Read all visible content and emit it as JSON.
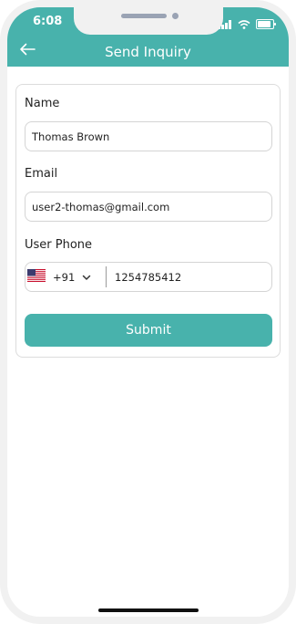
{
  "status_bar": {
    "time": "6:08"
  },
  "header": {
    "title": "Send Inquiry"
  },
  "form": {
    "name_label": "Name",
    "name_value": "Thomas Brown",
    "email_label": "Email",
    "email_value": "user2-thomas@gmail.com",
    "phone_label": "User Phone",
    "country_code": "+91",
    "phone_value": "1254785412",
    "submit_label": "Submit"
  },
  "colors": {
    "accent": "#48b2ac"
  },
  "icons": {
    "back": "arrow-left-icon",
    "flag": "us-flag-icon",
    "dropdown": "chevron-down-icon",
    "signal": "signal-icon",
    "wifi": "wifi-icon",
    "battery": "battery-icon"
  }
}
